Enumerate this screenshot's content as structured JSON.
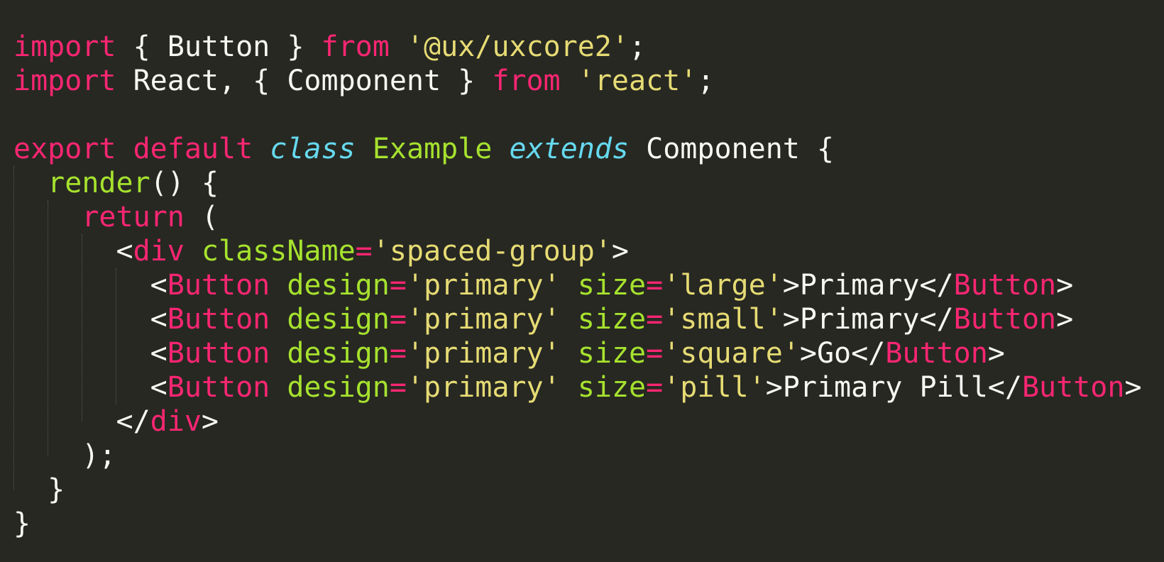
{
  "editor": {
    "theme_colors": {
      "background": "#272822",
      "keyword": "#F92672",
      "string": "#E6DB74",
      "plain": "#F8F8F2",
      "storage": "#66D9EF",
      "entity": "#A6E22E"
    },
    "lines": [
      [
        {
          "t": "import",
          "c": "kw"
        },
        {
          "t": " { Button } ",
          "c": "plain"
        },
        {
          "t": "from",
          "c": "kw"
        },
        {
          "t": " ",
          "c": "plain"
        },
        {
          "t": "'@ux/uxcore2'",
          "c": "str"
        },
        {
          "t": ";",
          "c": "plain"
        }
      ],
      [
        {
          "t": "import",
          "c": "kw"
        },
        {
          "t": " React, { Component } ",
          "c": "plain"
        },
        {
          "t": "from",
          "c": "kw"
        },
        {
          "t": " ",
          "c": "plain"
        },
        {
          "t": "'react'",
          "c": "str"
        },
        {
          "t": ";",
          "c": "plain"
        }
      ],
      [],
      [
        {
          "t": "export",
          "c": "kw"
        },
        {
          "t": " ",
          "c": "plain"
        },
        {
          "t": "default",
          "c": "kw"
        },
        {
          "t": " ",
          "c": "plain"
        },
        {
          "t": "class",
          "c": "storage"
        },
        {
          "t": " ",
          "c": "plain"
        },
        {
          "t": "Example",
          "c": "cls"
        },
        {
          "t": " ",
          "c": "plain"
        },
        {
          "t": "extends",
          "c": "storage"
        },
        {
          "t": " Component {",
          "c": "plain"
        }
      ],
      [
        {
          "t": "  ",
          "c": "plain"
        },
        {
          "t": "render",
          "c": "fn"
        },
        {
          "t": "() {",
          "c": "plain"
        }
      ],
      [
        {
          "t": "    ",
          "c": "plain"
        },
        {
          "t": "return",
          "c": "kw"
        },
        {
          "t": " (",
          "c": "plain"
        }
      ],
      [
        {
          "t": "      <",
          "c": "plain"
        },
        {
          "t": "div",
          "c": "tag"
        },
        {
          "t": " ",
          "c": "plain"
        },
        {
          "t": "className",
          "c": "attr"
        },
        {
          "t": "=",
          "c": "kw"
        },
        {
          "t": "'spaced-group'",
          "c": "str"
        },
        {
          "t": ">",
          "c": "plain"
        }
      ],
      [
        {
          "t": "        <",
          "c": "plain"
        },
        {
          "t": "Button",
          "c": "tag"
        },
        {
          "t": " ",
          "c": "plain"
        },
        {
          "t": "design",
          "c": "attr"
        },
        {
          "t": "=",
          "c": "kw"
        },
        {
          "t": "'primary'",
          "c": "str"
        },
        {
          "t": " ",
          "c": "plain"
        },
        {
          "t": "size",
          "c": "attr"
        },
        {
          "t": "=",
          "c": "kw"
        },
        {
          "t": "'large'",
          "c": "str"
        },
        {
          "t": ">Primary</",
          "c": "plain"
        },
        {
          "t": "Button",
          "c": "tag"
        },
        {
          "t": ">",
          "c": "plain"
        }
      ],
      [
        {
          "t": "        <",
          "c": "plain"
        },
        {
          "t": "Button",
          "c": "tag"
        },
        {
          "t": " ",
          "c": "plain"
        },
        {
          "t": "design",
          "c": "attr"
        },
        {
          "t": "=",
          "c": "kw"
        },
        {
          "t": "'primary'",
          "c": "str"
        },
        {
          "t": " ",
          "c": "plain"
        },
        {
          "t": "size",
          "c": "attr"
        },
        {
          "t": "=",
          "c": "kw"
        },
        {
          "t": "'small'",
          "c": "str"
        },
        {
          "t": ">Primary</",
          "c": "plain"
        },
        {
          "t": "Button",
          "c": "tag"
        },
        {
          "t": ">",
          "c": "plain"
        }
      ],
      [
        {
          "t": "        <",
          "c": "plain"
        },
        {
          "t": "Button",
          "c": "tag"
        },
        {
          "t": " ",
          "c": "plain"
        },
        {
          "t": "design",
          "c": "attr"
        },
        {
          "t": "=",
          "c": "kw"
        },
        {
          "t": "'primary'",
          "c": "str"
        },
        {
          "t": " ",
          "c": "plain"
        },
        {
          "t": "size",
          "c": "attr"
        },
        {
          "t": "=",
          "c": "kw"
        },
        {
          "t": "'square'",
          "c": "str"
        },
        {
          "t": ">Go</",
          "c": "plain"
        },
        {
          "t": "Button",
          "c": "tag"
        },
        {
          "t": ">",
          "c": "plain"
        }
      ],
      [
        {
          "t": "        <",
          "c": "plain"
        },
        {
          "t": "Button",
          "c": "tag"
        },
        {
          "t": " ",
          "c": "plain"
        },
        {
          "t": "design",
          "c": "attr"
        },
        {
          "t": "=",
          "c": "kw"
        },
        {
          "t": "'primary'",
          "c": "str"
        },
        {
          "t": " ",
          "c": "plain"
        },
        {
          "t": "size",
          "c": "attr"
        },
        {
          "t": "=",
          "c": "kw"
        },
        {
          "t": "'pill'",
          "c": "str"
        },
        {
          "t": ">Primary Pill</",
          "c": "plain"
        },
        {
          "t": "Button",
          "c": "tag"
        },
        {
          "t": ">",
          "c": "plain"
        }
      ],
      [
        {
          "t": "      </",
          "c": "plain"
        },
        {
          "t": "div",
          "c": "tag"
        },
        {
          "t": ">",
          "c": "plain"
        }
      ],
      [
        {
          "t": "    );",
          "c": "plain"
        }
      ],
      [
        {
          "t": "  }",
          "c": "plain"
        }
      ],
      [
        {
          "t": "}",
          "c": "plain"
        }
      ]
    ]
  }
}
